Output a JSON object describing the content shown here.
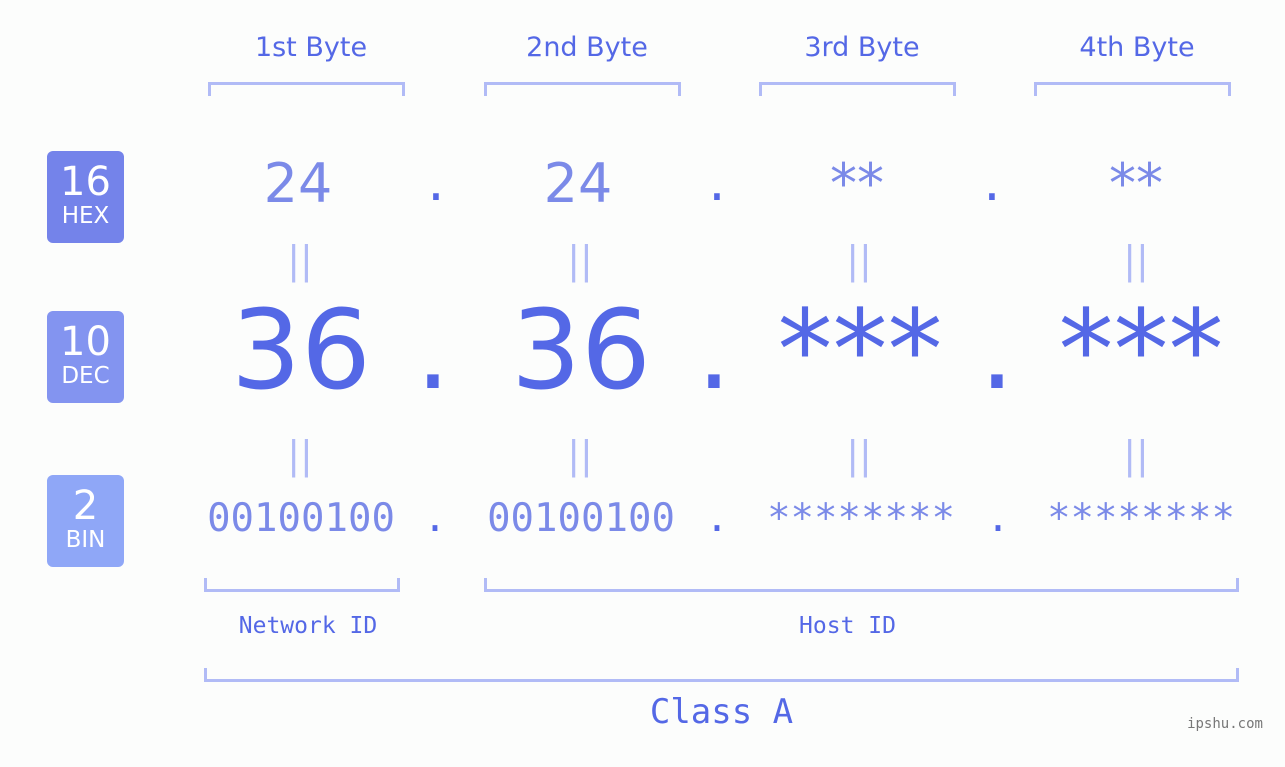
{
  "colors": {
    "accent": "#5468e6",
    "light_value": "#7b8ae8",
    "bracket": "#b1bbf6",
    "hex_badge": "#7483ea",
    "dec_badge": "#8394f0",
    "bin_badge": "#8fa7f7",
    "background": "#fcfdfc"
  },
  "bytes": [
    {
      "label": "1st Byte",
      "hex": "24",
      "dec": "36",
      "bin": "00100100"
    },
    {
      "label": "2nd Byte",
      "hex": "24",
      "dec": "36",
      "bin": "00100100"
    },
    {
      "label": "3rd Byte",
      "hex": "**",
      "dec": "***",
      "bin": "********"
    },
    {
      "label": "4th Byte",
      "hex": "**",
      "dec": "***",
      "bin": "********"
    }
  ],
  "separator": ".",
  "equals": "||",
  "badges": {
    "hex": {
      "num": "16",
      "label": "HEX"
    },
    "dec": {
      "num": "10",
      "label": "DEC"
    },
    "bin": {
      "num": "2",
      "label": "BIN"
    }
  },
  "groups": {
    "network_id": "Network ID",
    "host_id": "Host ID",
    "class": "Class A"
  },
  "watermark": "ipshu.com"
}
